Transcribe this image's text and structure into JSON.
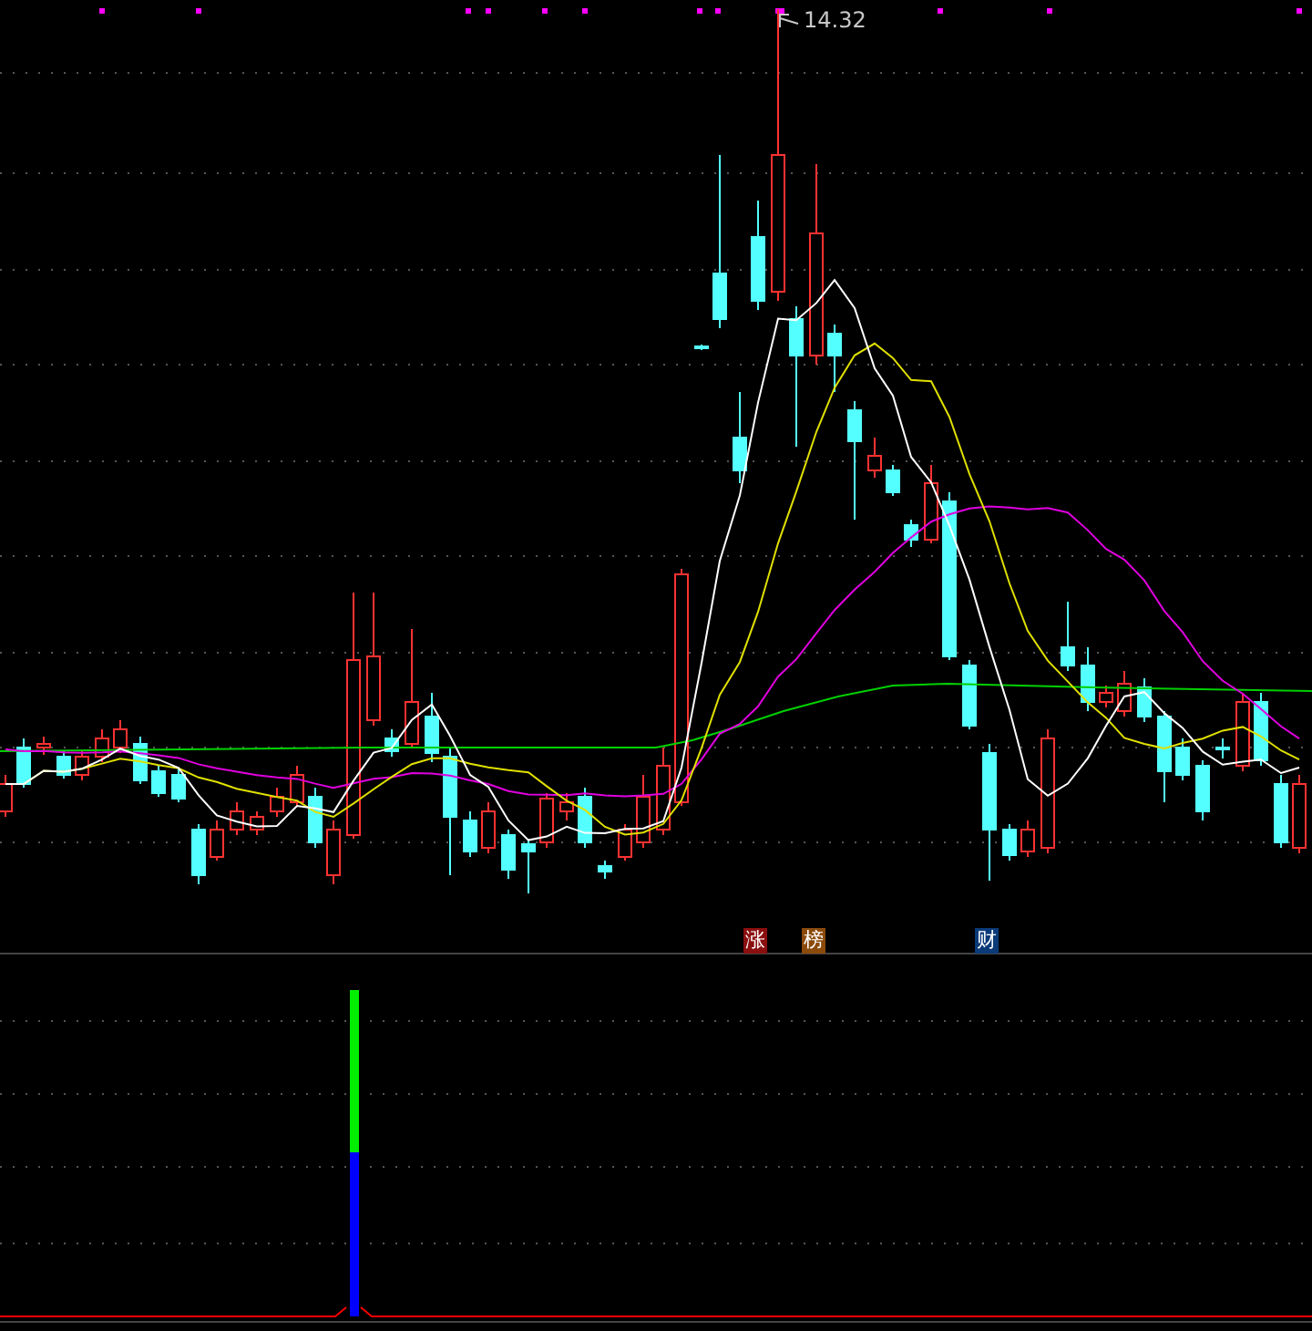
{
  "chart": {
    "peak_label": "14.32"
  },
  "markers": [
    {
      "text": "涨",
      "color": "#8b0f0f"
    },
    {
      "text": "榜",
      "color": "#8b4a0a"
    },
    {
      "text": "财",
      "color": "#0a3a78"
    }
  ]
}
